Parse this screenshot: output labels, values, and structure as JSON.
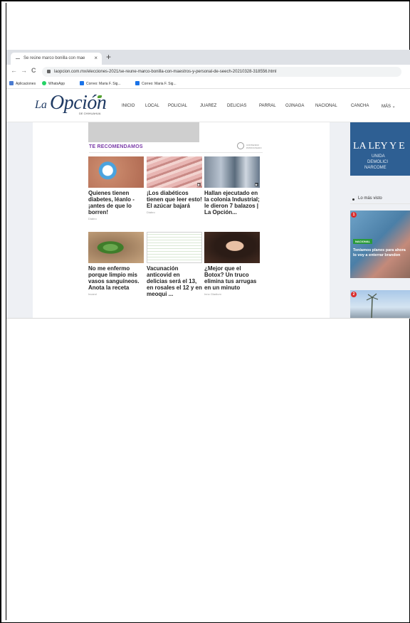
{
  "browser": {
    "tab_title": "Se reúne marco bonilla con mae",
    "tab_close": "×",
    "new_tab": "+",
    "back": "←",
    "forward": "→",
    "reload": "C",
    "url": "laopcion.com.mx/elecciones-2021/se-reune-marco-bonilla-con-maestros-y-personal-de-seech-20210328-318556.html",
    "bookmarks": [
      "Aplicaciones",
      "WhatsApp",
      "Correo: Maria F. Sig...",
      "Correo: Maria F. Sig..."
    ],
    "bookmark_colors": [
      "#4a7bd0",
      "#25d366",
      "#1a73e8",
      "#1a73e8"
    ]
  },
  "site": {
    "logo_la": "La",
    "logo_opcion": "Opción",
    "logo_sub": "DE CHIHUAHUA",
    "nav": [
      "INICIO",
      "LOCAL",
      "POLICIAL",
      "JUAREZ",
      "DELICIAS",
      "PARRAL",
      "OJINAGA",
      "NACIONAL",
      "CANCHA",
      "MÁS ⌄"
    ],
    "brand_color": "#1f3a63"
  },
  "recommendations": {
    "title": "TE RECOMENDAMOS",
    "badge_text": "CONTENIDO PATROCINADO",
    "cards": [
      {
        "caption": "Quienes tienen diabetes, léanlo - ¡antes de que lo borren!",
        "source": "Diabro",
        "thumb": "blue-glove-hand",
        "video": false
      },
      {
        "caption": "¡Los diabéticos tienen que leer esto! El azúcar bajará",
        "source": "Diabro",
        "thumb": "raw-meat",
        "video": true
      },
      {
        "caption": "Hallan ejecutado en la colonia Industrial; le dieron 7 balazos | La Opción...",
        "source": "",
        "thumb": "crime-scene",
        "video": true
      },
      {
        "caption": "No me enfermo porque limpio mis vasos sanguíneos. Anota la receta",
        "source": "Incarol",
        "thumb": "green-leaves",
        "video": false
      },
      {
        "caption": "Vacunación anticovid en delicias será el 13, en rosales el 12 y en meoqui ...",
        "source": "",
        "thumb": "document-table",
        "video": false
      },
      {
        "caption": "¿Mejor que el Botox? Un truco elimina tus arrugas en un minuto",
        "source": "Inno Gladium",
        "thumb": "woman-face",
        "video": false
      }
    ]
  },
  "sidebar": {
    "ad_title": "LA LEY Y E",
    "ad_lines": [
      "UNIDA",
      "DEMOLICI",
      "NARCOME"
    ],
    "most_viewed_label": "Lo más visto",
    "items": [
      {
        "rank": "1",
        "tag": "NACIONAL",
        "caption": "Teníamos planes para ahora lo voy a enterrar brandon"
      },
      {
        "rank": "2",
        "tag": "",
        "caption": ""
      }
    ]
  }
}
